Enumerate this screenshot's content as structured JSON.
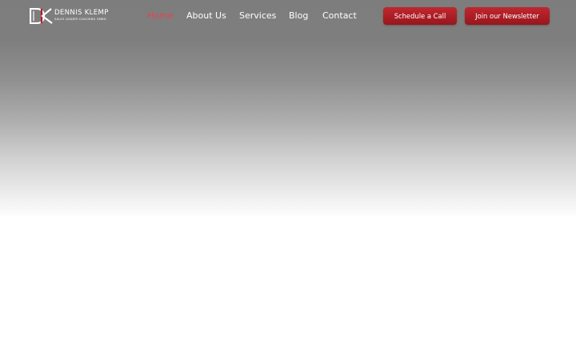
{
  "brand": {
    "name": "DENNIS KLEMP",
    "tagline": "SALES LEADER COACHING GMBH",
    "accent_color": "#b41f27",
    "logo_mark_icon": "dk-monogram-icon"
  },
  "nav": {
    "items": [
      {
        "label": "Home",
        "active": true
      },
      {
        "label": "About Us",
        "active": false
      },
      {
        "label": "Services",
        "active": false
      },
      {
        "label": "Blog",
        "active": false
      },
      {
        "label": "Contact",
        "active": false
      }
    ],
    "active_color": "#e8424b"
  },
  "actions": {
    "schedule_call": "Schedule a Call",
    "newsletter": "Join our Newsletter"
  }
}
